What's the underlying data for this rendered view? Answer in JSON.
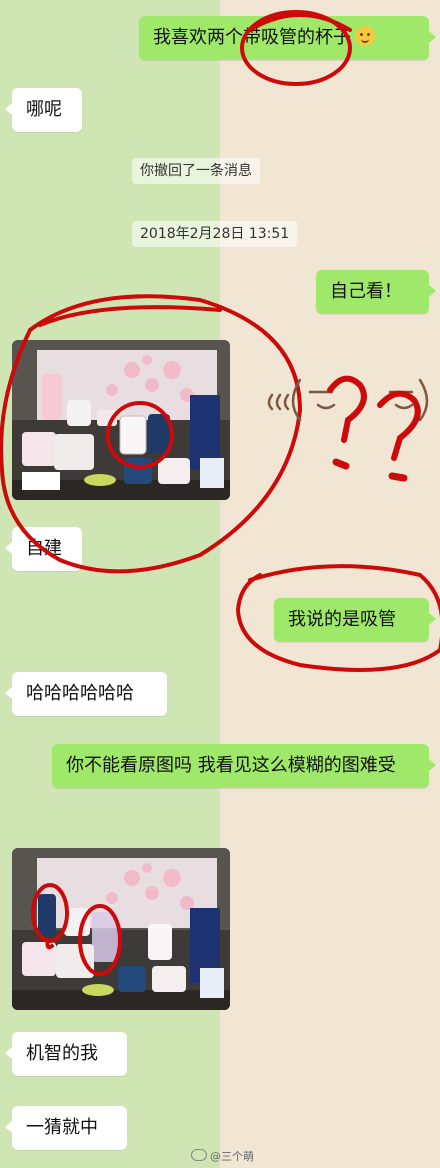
{
  "messages": [
    {
      "side": "right",
      "text": "我喜欢两个带吸管的杯子",
      "emoji": "smiling-face-emoji"
    },
    {
      "side": "left",
      "text": "哪呢"
    },
    {
      "side": "system",
      "text": "你撤回了一条消息"
    },
    {
      "side": "system",
      "text": "2018年2月28日 13:51"
    },
    {
      "side": "right",
      "text": "自己看！"
    },
    {
      "side": "left",
      "type": "image"
    },
    {
      "side": "left",
      "text": "自建"
    },
    {
      "side": "right",
      "text": "我说的是吸管"
    },
    {
      "side": "left",
      "text": "哈哈哈哈哈哈"
    },
    {
      "side": "right",
      "text": "你不能看原图吗 我看见这么模糊的图难受"
    },
    {
      "side": "left",
      "type": "image"
    },
    {
      "side": "left",
      "text": "机智的我"
    },
    {
      "side": "left",
      "text": "一猜就中"
    }
  ],
  "overlay": {
    "doodle_face": "ε(ʘ̄ ̄ ̄ʘ)з",
    "doodle_marks": "??",
    "color": "#cc0a0a"
  },
  "watermark": {
    "text": "@三个萌"
  }
}
